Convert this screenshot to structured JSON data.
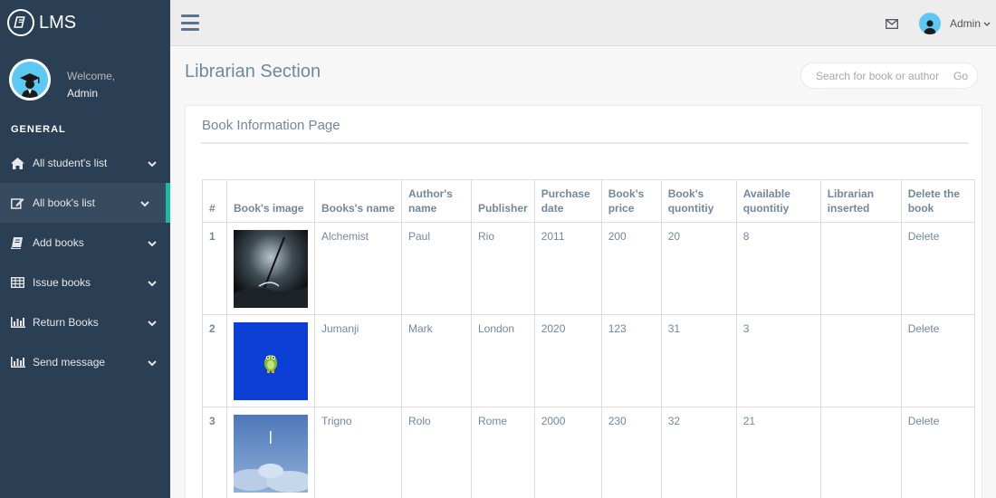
{
  "brand": {
    "name": "LMS"
  },
  "profile": {
    "welcome": "Welcome,",
    "name": "Admin"
  },
  "sidebar": {
    "section": "GENERAL",
    "items": [
      {
        "label": "All student's list",
        "icon": "home-icon"
      },
      {
        "label": "All book's list",
        "icon": "edit-icon",
        "active": true
      },
      {
        "label": "Add books",
        "icon": "book-icon"
      },
      {
        "label": "Issue books",
        "icon": "table-icon"
      },
      {
        "label": "Return Books",
        "icon": "bar-chart-icon"
      },
      {
        "label": "Send message",
        "icon": "bar-chart-icon"
      }
    ]
  },
  "topnav": {
    "user": "Admin"
  },
  "page": {
    "title": "Librarian Section",
    "search_placeholder": "Search for book or author",
    "search_go": "Go",
    "panel_title": "Book Information Page"
  },
  "table": {
    "headers": [
      "#",
      "Book's image",
      "Books's name",
      "Author's name",
      "Publisher",
      "Purchase date",
      "Book's price",
      "Book's quontitiy",
      "Available quontitiy",
      "Librarian inserted",
      "Delete the book"
    ],
    "rows": [
      {
        "num": "1",
        "name": "Alchemist",
        "author": "Paul",
        "publisher": "Rio",
        "date": "2011",
        "price": "200",
        "qty": "20",
        "available": "8",
        "librarian": "",
        "delete": "Delete"
      },
      {
        "num": "2",
        "name": "Jumanji",
        "author": "Mark",
        "publisher": "London",
        "date": "2020",
        "price": "123",
        "qty": "31",
        "available": "3",
        "librarian": "",
        "delete": "Delete"
      },
      {
        "num": "3",
        "name": "Trigno",
        "author": "Rolo",
        "publisher": "Rome",
        "date": "2000",
        "price": "230",
        "qty": "32",
        "available": "21",
        "librarian": "",
        "delete": "Delete"
      }
    ]
  },
  "colors": {
    "sidebar": "#2a3f54",
    "accent": "#1abb9c",
    "text": "#73879c"
  }
}
